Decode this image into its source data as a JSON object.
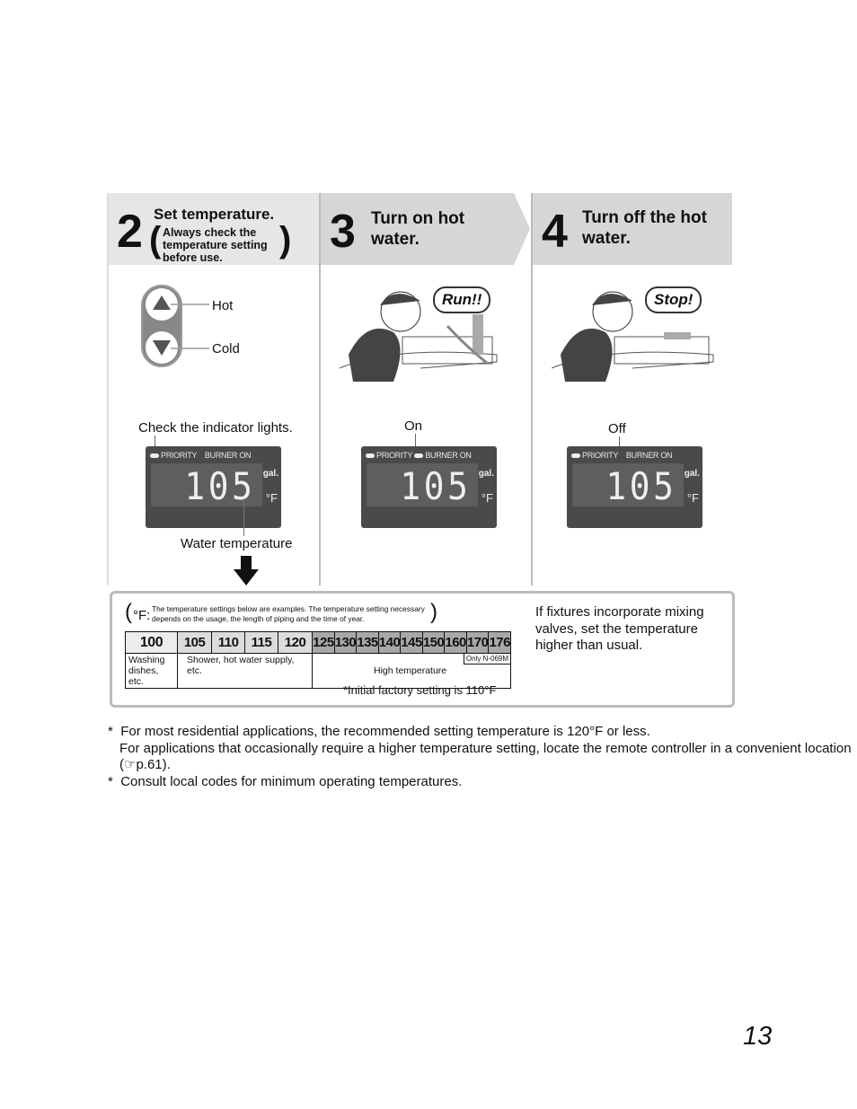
{
  "steps": [
    {
      "number": "2",
      "title": "Set temperature.",
      "note": "Always check the temperature setting before use."
    },
    {
      "number": "3",
      "title": "Turn on hot water."
    },
    {
      "number": "4",
      "title": "Turn off the hot water."
    }
  ],
  "step2": {
    "hot_label": "Hot",
    "cold_label": "Cold",
    "check_label": "Check the indicator lights.",
    "water_temp_label": "Water temperature"
  },
  "step3": {
    "bubble": "Run!!",
    "indicator_label": "On"
  },
  "step4": {
    "bubble": "Stop!",
    "indicator_label": "Off"
  },
  "display": {
    "priority": "PRIORITY",
    "burner": "BURNER ON",
    "value": "105",
    "unit_gal": "gal.",
    "unit_f": "°F"
  },
  "temp_box": {
    "unit": "°F:",
    "note": "The temperature settings below are examples.  The temperature setting necessary depends on the usage, the length of piping and the time of year.",
    "values": [
      "100",
      "105",
      "110",
      "115",
      "120",
      "125",
      "130",
      "135",
      "140",
      "145",
      "150",
      "160",
      "170",
      "176"
    ],
    "usage": {
      "washing": "Washing dishes, etc.",
      "shower": "Shower, hot water supply, etc.",
      "high": "High temperature",
      "only": "Only N-069M"
    },
    "factory_note": "*Initial factory setting is 110°F",
    "mixing_note": "If fixtures incorporate mixing valves, set the temperature higher than usual."
  },
  "notes": [
    "For most residential applications, the recommended setting temperature is 120°F or less.",
    "For applications that occasionally require a higher temperature setting, locate the remote controller in a convenient location (☞p.61).",
    "Consult local codes for minimum operating temperatures."
  ],
  "page_number": "13"
}
